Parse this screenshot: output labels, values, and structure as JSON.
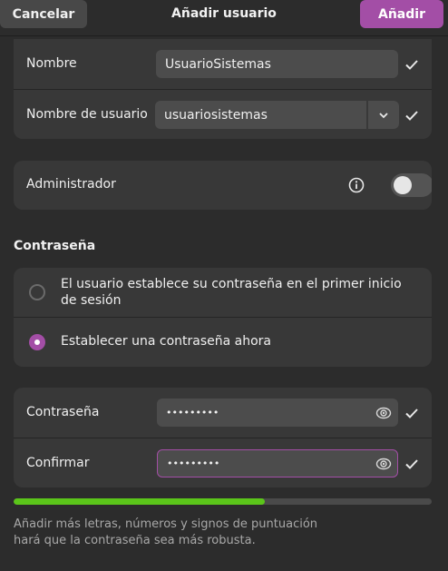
{
  "header": {
    "cancel_label": "Cancelar",
    "title": "Añadir usuario",
    "add_label": "Añadir"
  },
  "identity": {
    "name_label": "Nombre",
    "name_value": "UsuarioSistemas",
    "username_label": "Nombre de usuario",
    "username_value": "usuariosistemas"
  },
  "admin": {
    "label": "Administrador",
    "enabled": false
  },
  "password_section": {
    "title": "Contraseña",
    "option_later_label": "El usuario establece su contraseña en el primer inicio de sesión",
    "option_now_label": "Establecer una contraseña ahora",
    "selected": "now"
  },
  "password_fields": {
    "password_label": "Contraseña",
    "password_value": "•••••••••",
    "confirm_label": "Confirmar",
    "confirm_value": "•••••••••"
  },
  "strength": {
    "fraction": 0.6,
    "hint": "Añadir más letras, números y signos de puntuación hará que la contraseña sea más robusta."
  },
  "colors": {
    "accent": "#a34ea6",
    "strength_fill": "#5bc51a"
  }
}
